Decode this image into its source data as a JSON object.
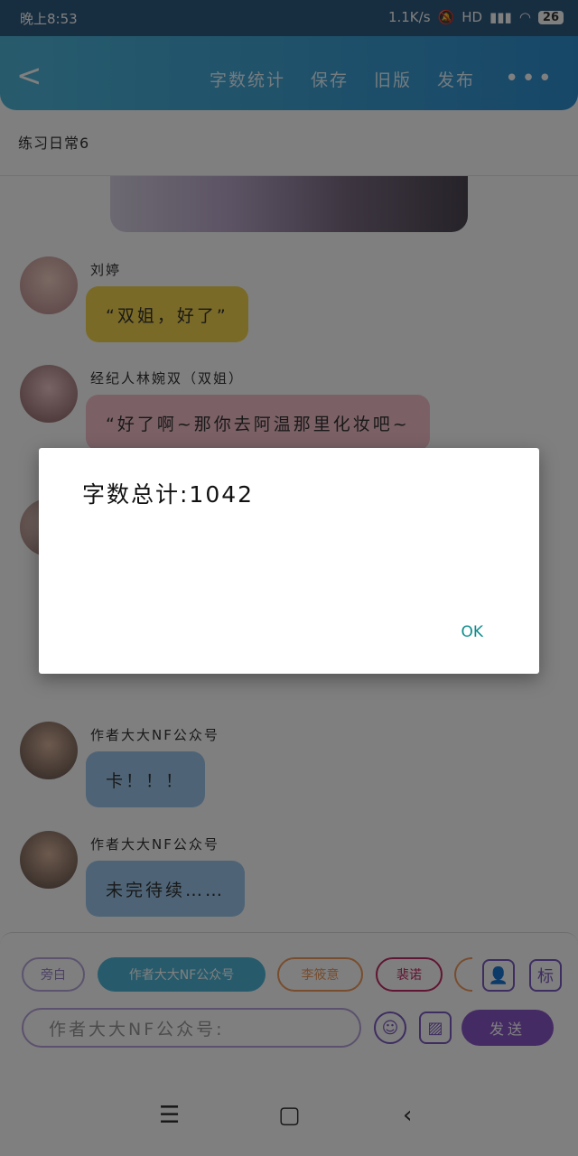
{
  "status_bar": {
    "time": "晚上8:53",
    "network_speed": "1.1K/s",
    "signal": "HD",
    "battery": "26"
  },
  "app_bar": {
    "back_icon": "chevron-left-icon",
    "menu": [
      "字数统计",
      "保存",
      "旧版",
      "发布"
    ],
    "more_icon": "more-dots-icon"
  },
  "chapter_title": "练习日常6",
  "messages": [
    {
      "name": "刘婷",
      "text": "“双姐，好了”",
      "color": "yellow"
    },
    {
      "name": "经纪人林婉双（双姐）",
      "text": "“好了啊~那你去阿温那里化妆吧~",
      "color": "pink"
    },
    {
      "name": "作者大大NF公众号",
      "text": "卡！！！",
      "color": "blue"
    },
    {
      "name": "作者大大NF公众号",
      "text": "未完待续……",
      "color": "blue"
    }
  ],
  "role_chips": [
    "旁白",
    "作者大大NF公众号",
    "李筱意",
    "裴诺"
  ],
  "input": {
    "placeholder": "作者大大NF公众号:"
  },
  "toolbar": {
    "role_icon": "person-icon",
    "tag_label": "标",
    "emoji_icon": "emoji-icon",
    "image_icon": "image-icon",
    "send_label": "发送"
  },
  "nav": {
    "menu_icon": "menu-icon",
    "home_icon": "home-square-icon",
    "back_icon": "back-triangle-icon"
  },
  "dialog": {
    "message": "字数总计:1042",
    "ok_label": "OK"
  }
}
